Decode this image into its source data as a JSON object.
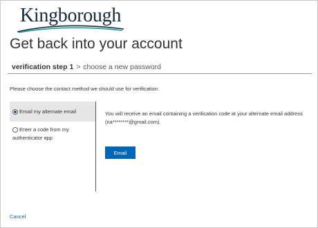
{
  "brand": {
    "logo_text": "Kingborough",
    "swoosh_colors": [
      "#15293f",
      "#1e9c8f"
    ]
  },
  "page": {
    "title": "Get back into your account"
  },
  "steps": {
    "current": "verification step 1",
    "separator": ">",
    "next": "choose a new password"
  },
  "instruction": "Please choose the contact method we should use for verification:",
  "options": [
    {
      "label": "Email my alternate email",
      "selected": true
    },
    {
      "label": "Enter a code from my authenticator app",
      "selected": false
    }
  ],
  "detail": {
    "message": "You will receive an email containing a verification code at your alternate email address (na********@gmail.com).",
    "button_label": "Email"
  },
  "footer": {
    "cancel_label": "Cancel"
  },
  "colors": {
    "accent": "#0067b8",
    "selected_bg": "#e6e6e6"
  }
}
